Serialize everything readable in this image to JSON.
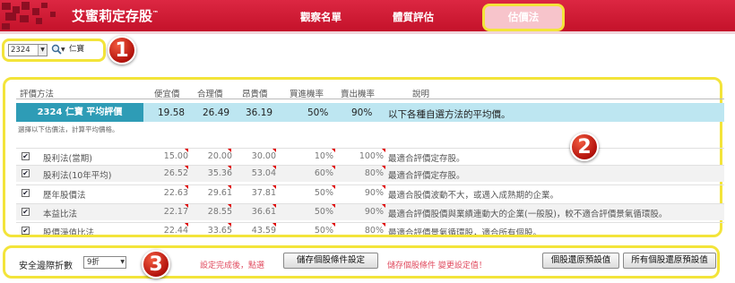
{
  "header": {
    "brand": "艾蜜莉定存股",
    "trademark": "™",
    "nav": [
      "觀察名單",
      "體質評估",
      "估價法"
    ],
    "brand_color": "#d41a34",
    "highlight_color": "#f3e43a"
  },
  "stock": {
    "code": "2324",
    "name": "仁寶",
    "search_icon": "search-icon"
  },
  "badges": [
    "1",
    "2",
    "3"
  ],
  "table": {
    "columns": [
      "評價方法",
      "便宜價",
      "合理價",
      "昂貴價",
      "買進機率",
      "賣出機率",
      "說明"
    ],
    "average": {
      "label": "2324 仁寶 平均評價",
      "cheap": "19.58",
      "fair": "26.49",
      "expensive": "36.19",
      "buy": "50%",
      "sell": "90%",
      "desc": "以下各種自選方法的平均價。"
    },
    "hint": "選擇以下估價法，計算平均價格。",
    "rows": [
      {
        "method": "股利法(當期)",
        "cheap": "15.00",
        "fair": "20.00",
        "expensive": "30.00",
        "buy": "10%",
        "sell": "100%",
        "desc": "最適合評價定存股。"
      },
      {
        "method": "股利法(10年平均)",
        "cheap": "26.52",
        "fair": "35.36",
        "expensive": "53.04",
        "buy": "60%",
        "sell": "80%",
        "desc": "最適合評價定存股。"
      },
      {
        "method": "歷年股價法",
        "cheap": "22.63",
        "fair": "29.61",
        "expensive": "37.81",
        "buy": "50%",
        "sell": "90%",
        "desc": "最適合股價波動不大，或邁入成熟期的企業。"
      },
      {
        "method": "本益比法",
        "cheap": "22.17",
        "fair": "28.55",
        "expensive": "36.61",
        "buy": "50%",
        "sell": "90%",
        "desc": "最適合評價股價與業績連動大的企業(一般股)，較不適合評價景氣循環股。"
      },
      {
        "method": "股價淨值比法",
        "cheap": "22.44",
        "fair": "33.65",
        "expensive": "43.59",
        "buy": "50%",
        "sell": "80%",
        "desc": "最適合評價景氣循環股，適合所有個股。"
      }
    ]
  },
  "bottom": {
    "label": "安全邊際折數",
    "discount_value": "9折",
    "note1": "設定完成後，點選",
    "save_button": "儲存個股條件設定",
    "note2": "儲存個股條件 變更設定值！",
    "reset_one": "個股還原預設值",
    "reset_all": "所有個股還原預設值"
  }
}
